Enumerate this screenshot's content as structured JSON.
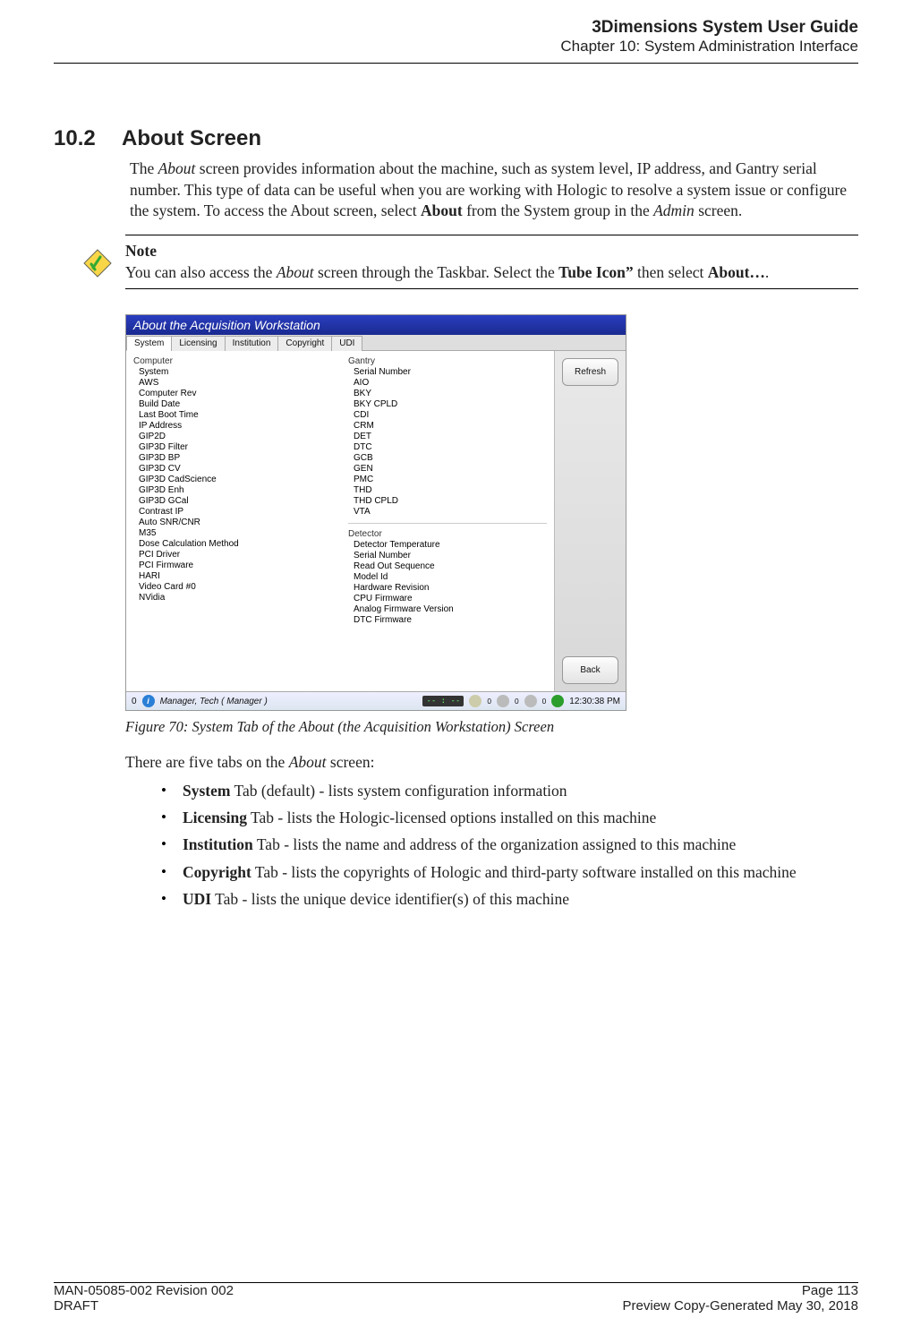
{
  "header": {
    "title": "3Dimensions System User Guide",
    "chapter": "Chapter 10: System Administration Interface"
  },
  "section": {
    "number": "10.2",
    "title": "About Screen"
  },
  "intro_text": "The About screen provides information about the machine, such as system level, IP address, and Gantry serial number. This type of data can be useful when you are working with Hologic to resolve a system issue or configure the system. To access the About screen, select About from the System group in the Admin screen.",
  "note": {
    "header": "Note",
    "text_pre": "You can also access the ",
    "text_mid1": "About",
    "text_mid2": " screen through the Taskbar. Select the ",
    "text_bold1": "Tube Icon”",
    "text_mid3": " then select ",
    "text_bold2": "About…",
    "text_end": "."
  },
  "screenshot": {
    "titlebar": "About the Acquisition Workstation",
    "tabs": [
      "System",
      "Licensing",
      "Institution",
      "Copyright",
      "UDI"
    ],
    "active_tab": 0,
    "left_group": "Computer",
    "left_items": [
      "System",
      "AWS",
      "Computer Rev",
      "Build Date",
      "Last Boot Time",
      "IP Address",
      "GIP2D",
      "GIP3D Filter",
      "GIP3D BP",
      "GIP3D CV",
      "GIP3D CadScience",
      "GIP3D Enh",
      "GIP3D GCal",
      "Contrast IP",
      "Auto SNR/CNR",
      "M35",
      "Dose Calculation Method",
      "PCI Driver",
      "PCI Firmware",
      "HARI",
      "Video Card #0",
      "NVidia"
    ],
    "right_group1": "Gantry",
    "right_items1": [
      "Serial Number",
      "AIO",
      "BKY",
      "BKY CPLD",
      "CDI",
      "CRM",
      "DET",
      "DTC",
      "GCB",
      "GEN",
      "PMC",
      "THD",
      "THD CPLD",
      "VTA"
    ],
    "right_group2": "Detector",
    "right_items2": [
      "Detector Temperature",
      "Serial Number",
      "Read Out Sequence",
      "Model Id",
      "Hardware Revision",
      "CPU Firmware",
      "Analog Firmware Version",
      "DTC Firmware"
    ],
    "buttons": {
      "refresh": "Refresh",
      "back": "Back"
    },
    "statusbar": {
      "zero": "0",
      "manager": "Manager, Tech ( Manager )",
      "clock": "-- : --",
      "z1": "0",
      "z2": "0",
      "z3": "0",
      "time": "12:30:38 PM"
    }
  },
  "caption": "Figure 70: System Tab of the About (the Acquisition Workstation) Screen",
  "subtext": "There are five tabs on the About screen:",
  "tabs_list": [
    {
      "bold": "System",
      "rest": " Tab (default) - lists system configuration information"
    },
    {
      "bold": "Licensing",
      "rest": " Tab - lists the Hologic-licensed options installed on this machine"
    },
    {
      "bold": "Institution",
      "rest": " Tab - lists the name and address of the organization assigned to this machine"
    },
    {
      "bold": "Copyright",
      "rest": " Tab - lists the copyrights of Hologic and third-party software installed on this machine"
    },
    {
      "bold": "UDI",
      "rest": " Tab - lists the unique device identifier(s) of this machine"
    }
  ],
  "footer": {
    "left1": "MAN-05085-002 Revision 002",
    "right1": "Page 113",
    "left2": "DRAFT",
    "right2": "Preview Copy-Generated May 30, 2018"
  }
}
